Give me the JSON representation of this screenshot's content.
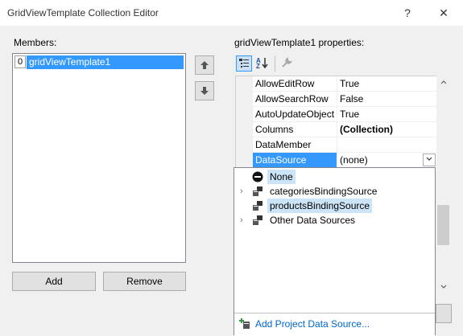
{
  "window": {
    "title": "GridViewTemplate Collection Editor",
    "help_glyph": "?",
    "close_glyph": "✕"
  },
  "members": {
    "label": "Members:",
    "items": [
      {
        "index": "0",
        "name": "gridViewTemplate1"
      }
    ],
    "up_glyph": "🡅",
    "down_glyph": "🡇",
    "add_label": "Add",
    "remove_label": "Remove"
  },
  "properties": {
    "label": "gridViewTemplate1 properties:",
    "toolbar": {
      "categorized_icon": "categorized-icon",
      "alphabetical_icon": "alphabetical-icon",
      "property_pages_icon": "wrench-icon"
    },
    "rows": [
      {
        "name": "AllowEditRow",
        "value": "True",
        "bold": false
      },
      {
        "name": "AllowSearchRow",
        "value": "False",
        "bold": false
      },
      {
        "name": "AutoUpdateObject",
        "value": "True",
        "bold": false
      },
      {
        "name": "Columns",
        "value": "(Collection)",
        "bold": true
      },
      {
        "name": "DataMember",
        "value": "",
        "bold": false
      },
      {
        "name": "DataSource",
        "value": "(none)",
        "bold": false
      }
    ],
    "dropdown_glyph": "⌄"
  },
  "datasource_popup": {
    "items": [
      {
        "label": "None",
        "expandable": false,
        "selected": false
      },
      {
        "label": "categoriesBindingSource",
        "expandable": true,
        "selected": false
      },
      {
        "label": "productsBindingSource",
        "expandable": false,
        "selected": true
      },
      {
        "label": "Other Data Sources",
        "expandable": true,
        "selected": false
      }
    ],
    "expander_glyph": "›",
    "footer_link": "Add Project Data Source..."
  },
  "colors": {
    "selection": "#3399ff",
    "soft_selection": "#cce4f7",
    "link": "#0066cc"
  }
}
